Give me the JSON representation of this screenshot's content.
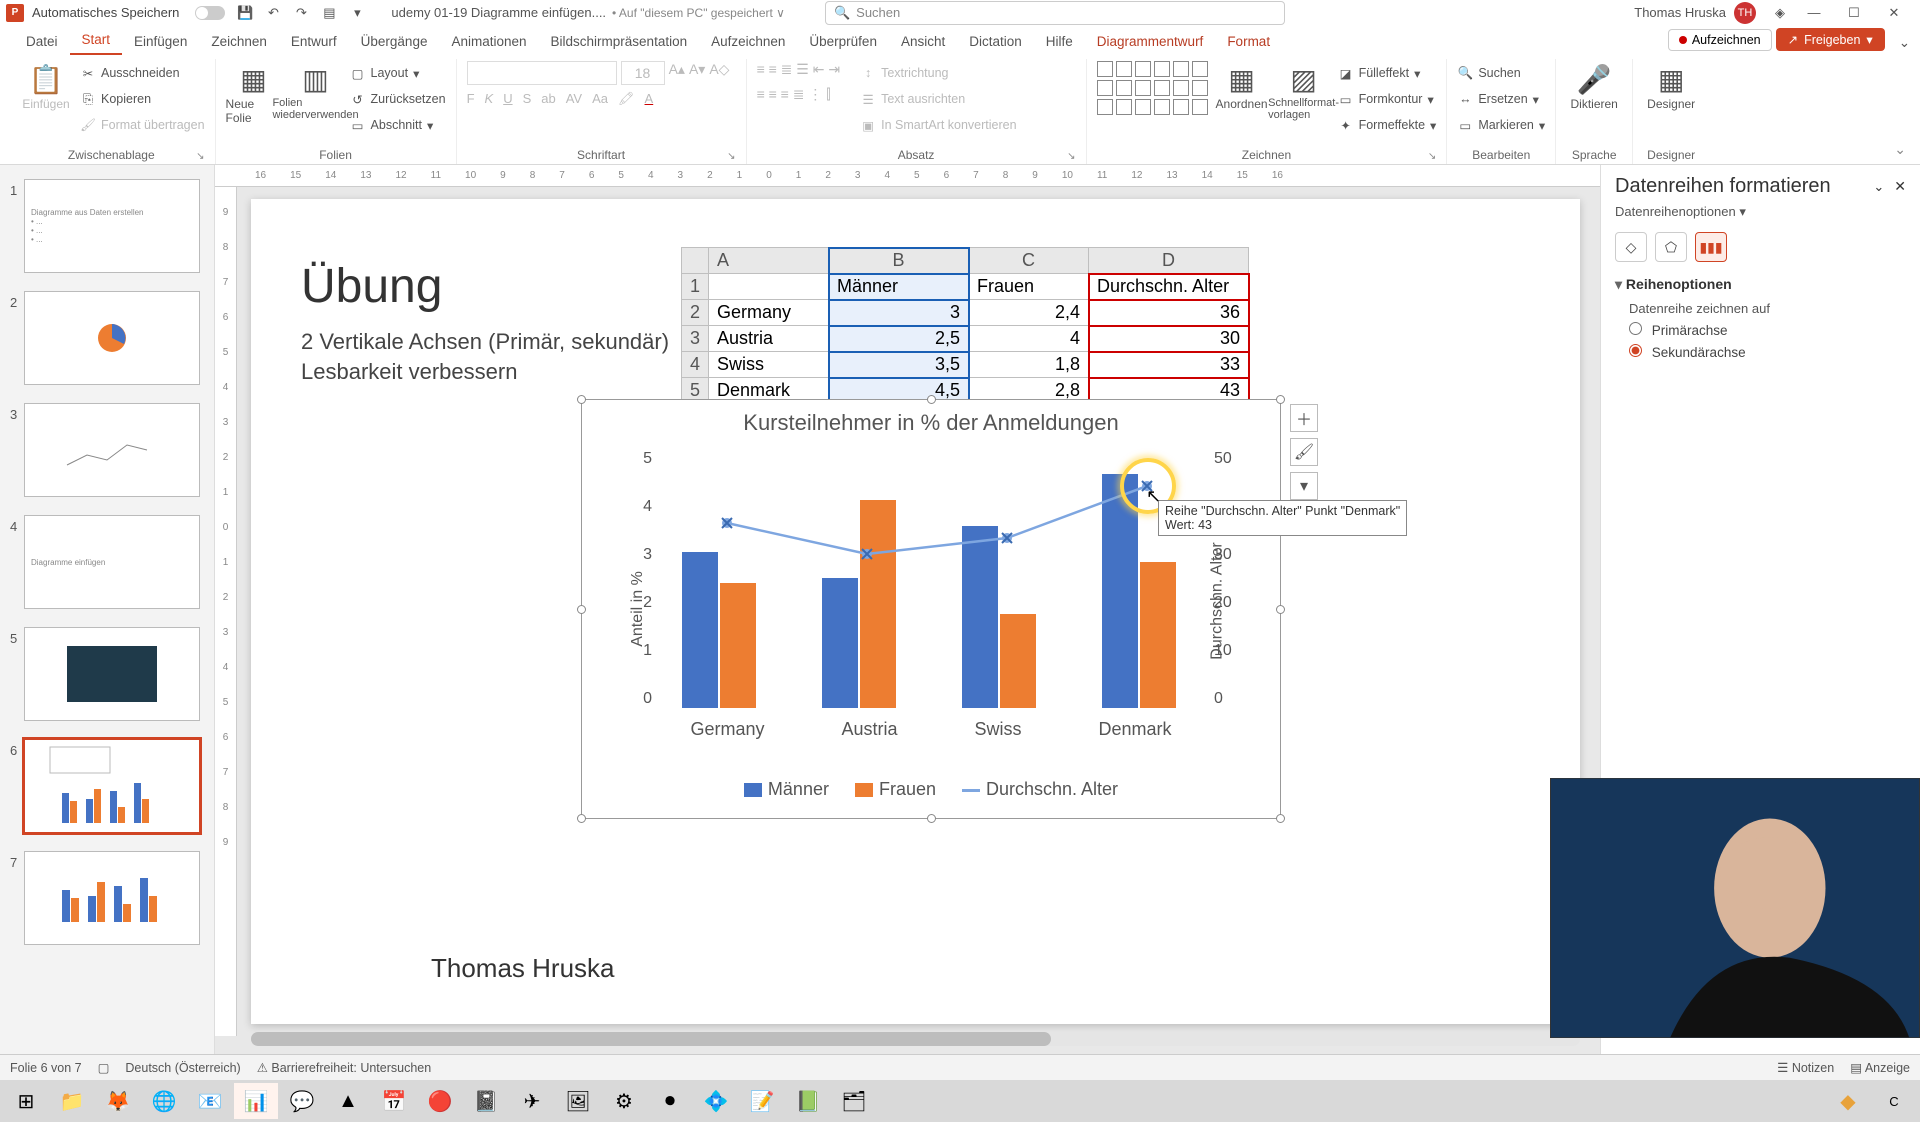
{
  "titlebar": {
    "autosave": "Automatisches Speichern",
    "filename": "udemy 01-19 Diagramme einfügen....",
    "saved_to": "• Auf \"diesem PC\" gespeichert ∨",
    "search_placeholder": "Suchen",
    "user": "Thomas Hruska"
  },
  "tabs": [
    "Datei",
    "Start",
    "Einfügen",
    "Zeichnen",
    "Entwurf",
    "Übergänge",
    "Animationen",
    "Bildschirmpräsentation",
    "Aufzeichnen",
    "Überprüfen",
    "Ansicht",
    "Dictation",
    "Hilfe",
    "Diagrammentwurf",
    "Format"
  ],
  "active_tab": 1,
  "context_tabs": [
    13,
    14
  ],
  "ribbon_right": {
    "record": "Aufzeichnen",
    "share": "Freigeben"
  },
  "groups": {
    "clipboard": {
      "label": "Zwischenablage",
      "paste": "Einfügen",
      "cut": "Ausschneiden",
      "copy": "Kopieren",
      "format_painter": "Format übertragen"
    },
    "slides": {
      "label": "Folien",
      "new_slide": "Neue Folie",
      "reuse": "Folien wiederverwenden",
      "layout": "Layout",
      "reset": "Zurücksetzen",
      "section": "Abschnitt"
    },
    "font": {
      "label": "Schriftart",
      "size": "18"
    },
    "paragraph": {
      "label": "Absatz",
      "text_dir": "Textrichtung",
      "align_text": "Text ausrichten",
      "smartart": "In SmartArt konvertieren"
    },
    "drawing": {
      "label": "Zeichnen",
      "arrange": "Anordnen",
      "quick": "Schnellformat-vorlagen",
      "fill": "Fülleffekt",
      "outline": "Formkontur",
      "effects": "Formeffekte"
    },
    "editing": {
      "label": "Bearbeiten",
      "find": "Suchen",
      "replace": "Ersetzen",
      "select": "Markieren"
    },
    "dictate": {
      "label": "Sprache",
      "btn": "Diktieren"
    },
    "designer": {
      "label": "Designer",
      "btn": "Designer"
    }
  },
  "ruler_h": [
    "16",
    "15",
    "14",
    "13",
    "12",
    "11",
    "10",
    "9",
    "8",
    "7",
    "6",
    "5",
    "4",
    "3",
    "2",
    "1",
    "0",
    "1",
    "2",
    "3",
    "4",
    "5",
    "6",
    "7",
    "8",
    "9",
    "10",
    "11",
    "12",
    "13",
    "14",
    "15",
    "16"
  ],
  "ruler_v": [
    "9",
    "8",
    "7",
    "6",
    "5",
    "4",
    "3",
    "2",
    "1",
    "0",
    "1",
    "2",
    "3",
    "4",
    "5",
    "6",
    "7",
    "8",
    "9"
  ],
  "slide": {
    "title": "Übung",
    "sub1": "2 Vertikale Achsen (Primär, sekundär)",
    "sub2": "Lesbarkeit verbessern",
    "author": "Thomas Hruska"
  },
  "table": {
    "col_letters": [
      "A",
      "B",
      "C",
      "D"
    ],
    "headers": [
      "",
      "Männer",
      "Frauen",
      "Durchschn. Alter"
    ],
    "rows": [
      {
        "n": "2",
        "label": "Germany",
        "b": "3",
        "c": "2,4",
        "d": "36"
      },
      {
        "n": "3",
        "label": "Austria",
        "b": "2,5",
        "c": "4",
        "d": "30"
      },
      {
        "n": "4",
        "label": "Swiss",
        "b": "3,5",
        "c": "1,8",
        "d": "33"
      },
      {
        "n": "5",
        "label": "Denmark",
        "b": "4,5",
        "c": "2,8",
        "d": "43"
      }
    ]
  },
  "chart_data": {
    "type": "bar+line",
    "title": "Kursteilnehmer in % der Anmeldungen",
    "categories": [
      "Germany",
      "Austria",
      "Swiss",
      "Denmark"
    ],
    "series": [
      {
        "name": "Männer",
        "type": "bar",
        "axis": "primary",
        "values": [
          3,
          2.5,
          3.5,
          4.5
        ],
        "color": "#4472c4"
      },
      {
        "name": "Frauen",
        "type": "bar",
        "axis": "primary",
        "values": [
          2.4,
          4,
          1.8,
          2.8
        ],
        "color": "#ed7d31"
      },
      {
        "name": "Durchschn. Alter",
        "type": "line",
        "axis": "secondary",
        "values": [
          36,
          30,
          33,
          43
        ],
        "color": "#7ea6e0"
      }
    ],
    "ylabel_primary": "Anteil in %",
    "ylabel_secondary": "Durchschn. Alter",
    "ylim_primary": [
      0,
      5
    ],
    "yticks_primary": [
      5,
      4,
      3,
      2,
      1,
      0
    ],
    "ylim_secondary": [
      0,
      50
    ],
    "yticks_secondary": [
      50,
      40,
      30,
      20,
      10,
      0
    ],
    "legend": [
      "Männer",
      "Frauen",
      "Durchschn. Alter"
    ],
    "tooltip": {
      "line1": "Reihe \"Durchschn. Alter\" Punkt \"Denmark\"",
      "line2": "Wert: 43"
    }
  },
  "pane": {
    "title": "Datenreihen formatieren",
    "subtitle": "Datenreihenoptionen",
    "section": "Reihenoptionen",
    "draw_on": "Datenreihe zeichnen auf",
    "opt_primary": "Primärachse",
    "opt_secondary": "Sekundärachse"
  },
  "status": {
    "slide_of": "Folie 6 von 7",
    "lang": "Deutsch (Österreich)",
    "access": "Barrierefreiheit: Untersuchen",
    "notes": "Notizen",
    "display": "Anzeige"
  },
  "thumb_count": 7,
  "selected_thumb": 6
}
